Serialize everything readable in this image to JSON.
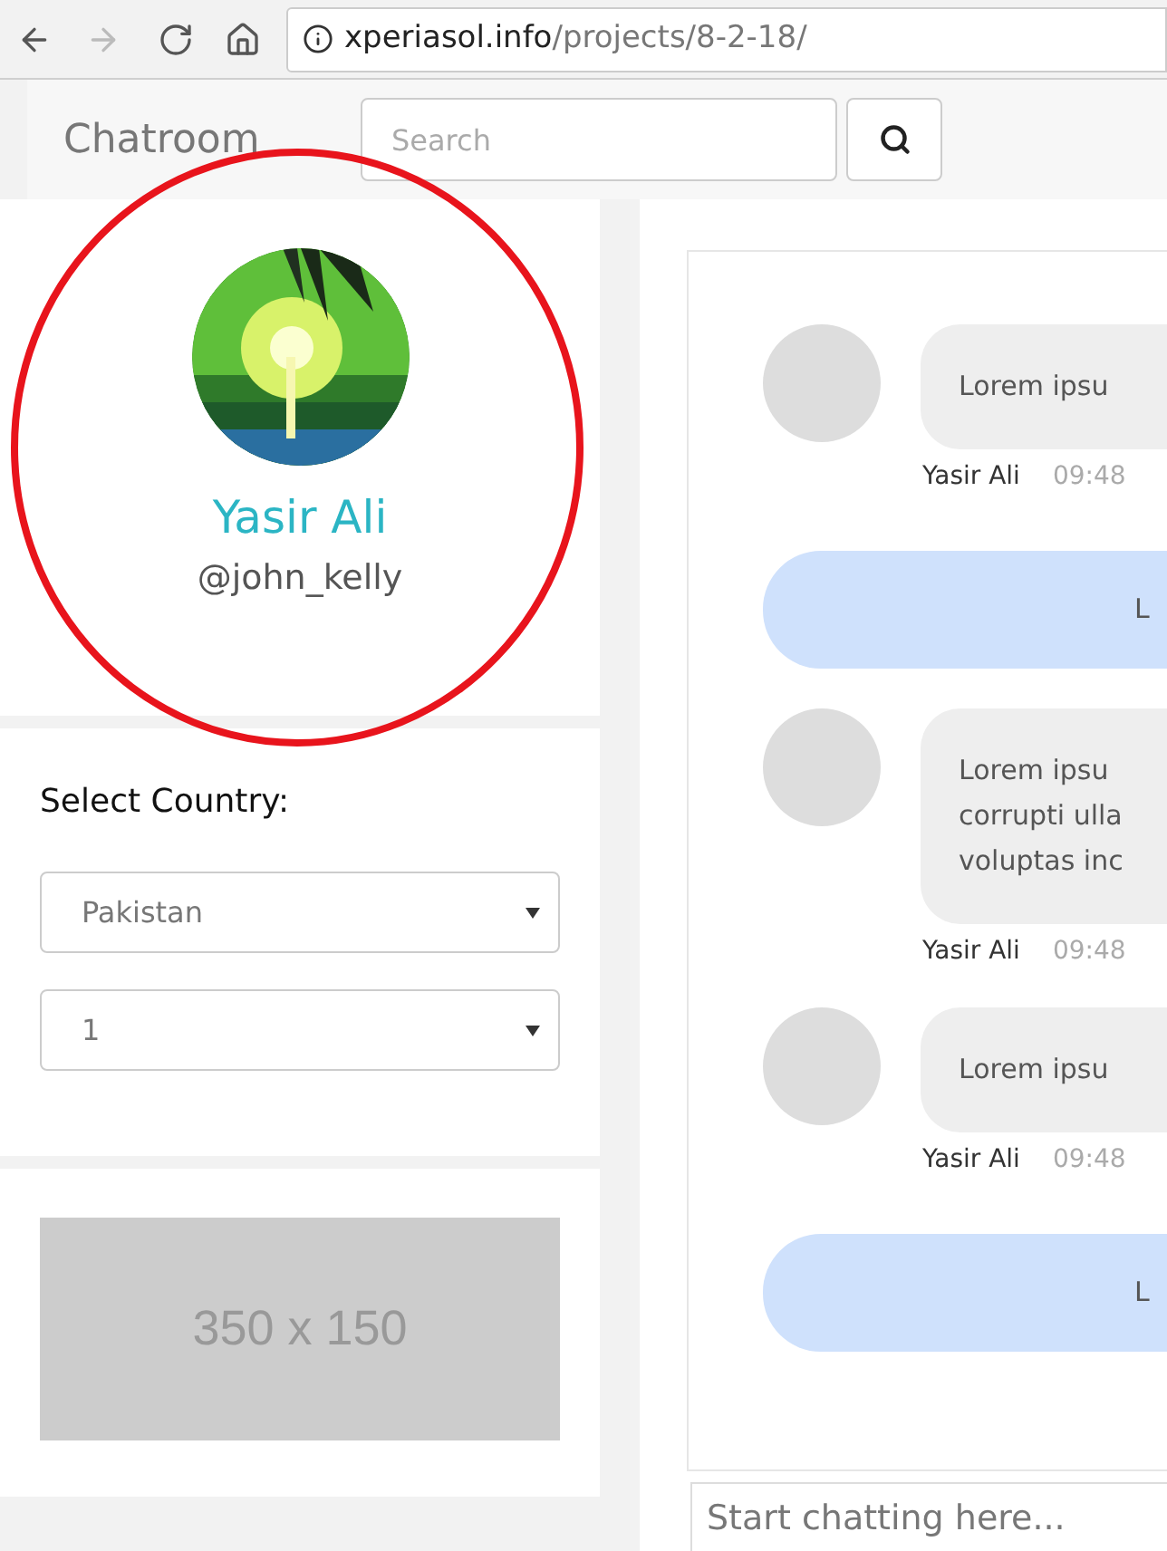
{
  "browser": {
    "url_host": "xperiasol.info",
    "url_path": "/projects/8-2-18/"
  },
  "navbar": {
    "brand": "Chatroom",
    "search": {
      "placeholder": "Search"
    }
  },
  "profile": {
    "name": "Yasir Ali",
    "handle": "@john_kelly"
  },
  "country_card": {
    "title": "Select Country:",
    "selects": [
      {
        "value": "Pakistan"
      },
      {
        "value": "1"
      }
    ]
  },
  "ad": {
    "text": "350 x 150"
  },
  "messages": [
    {
      "kind": "received",
      "lines": [
        "Lorem ipsu"
      ],
      "author": "Yasir Ali",
      "time": "09:48"
    },
    {
      "kind": "sent",
      "lines": [
        "L"
      ]
    },
    {
      "kind": "received",
      "lines": [
        "Lorem ipsu",
        "corrupti ulla",
        "voluptas inc"
      ],
      "author": "Yasir Ali",
      "time": "09:48"
    },
    {
      "kind": "received",
      "lines": [
        "Lorem ipsu"
      ],
      "author": "Yasir Ali",
      "time": "09:48"
    },
    {
      "kind": "sent",
      "lines": [
        "L"
      ]
    }
  ],
  "composer": {
    "placeholder": "Start chatting here..."
  }
}
